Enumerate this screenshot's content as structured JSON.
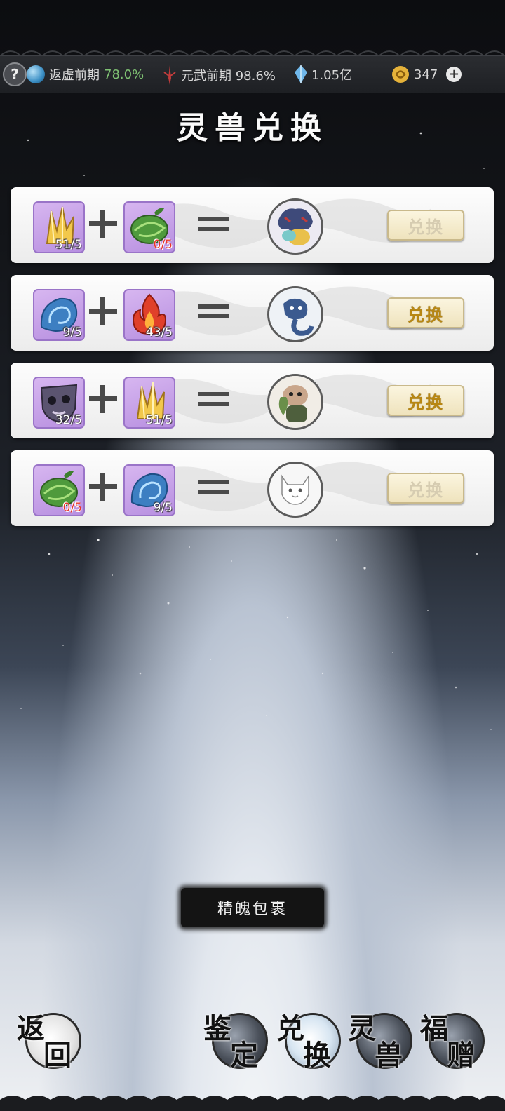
{
  "topbar": {
    "help_label": "?",
    "realm_name": "返虚前期",
    "realm_pct": "78.0%",
    "martial_label": "元武前期 98.6%",
    "crystal_amount": "1.05亿",
    "currency_amount": "347",
    "plus_label": "+"
  },
  "title": "灵兽兑换",
  "exchanges": [
    {
      "item_a": {
        "name": "gold-crystal",
        "count": "51/5",
        "red": false
      },
      "item_b": {
        "name": "green-leaf",
        "count": "0/5",
        "red": true
      },
      "beast": "beast-1",
      "button": "兑换",
      "active": false
    },
    {
      "item_a": {
        "name": "blue-wave",
        "count": "9/5",
        "red": false
      },
      "item_b": {
        "name": "red-flame",
        "count": "43/5",
        "red": false
      },
      "beast": "beast-2",
      "button": "兑换",
      "active": true
    },
    {
      "item_a": {
        "name": "dark-mask",
        "count": "32/5",
        "red": false
      },
      "item_b": {
        "name": "gold-crystal",
        "count": "51/5",
        "red": false
      },
      "beast": "beast-3",
      "button": "兑换",
      "active": true
    },
    {
      "item_a": {
        "name": "green-leaf",
        "count": "0/5",
        "red": true
      },
      "item_b": {
        "name": "blue-wave",
        "count": "9/5",
        "red": false
      },
      "beast": "beast-4",
      "button": "兑换",
      "active": false
    }
  ],
  "package_label": "精魄包裹",
  "nav": {
    "back": [
      "返",
      "回"
    ],
    "identify": [
      "鉴",
      "定"
    ],
    "exchange": [
      "兑",
      "换"
    ],
    "beast": [
      "灵",
      "兽"
    ],
    "gift": [
      "福",
      "赠"
    ]
  },
  "colors": {
    "active_button_text": "#b88712",
    "inactive_button_text": "#d6ccb1",
    "progress_green": "#7fc173",
    "count_red": "#e8342c"
  }
}
